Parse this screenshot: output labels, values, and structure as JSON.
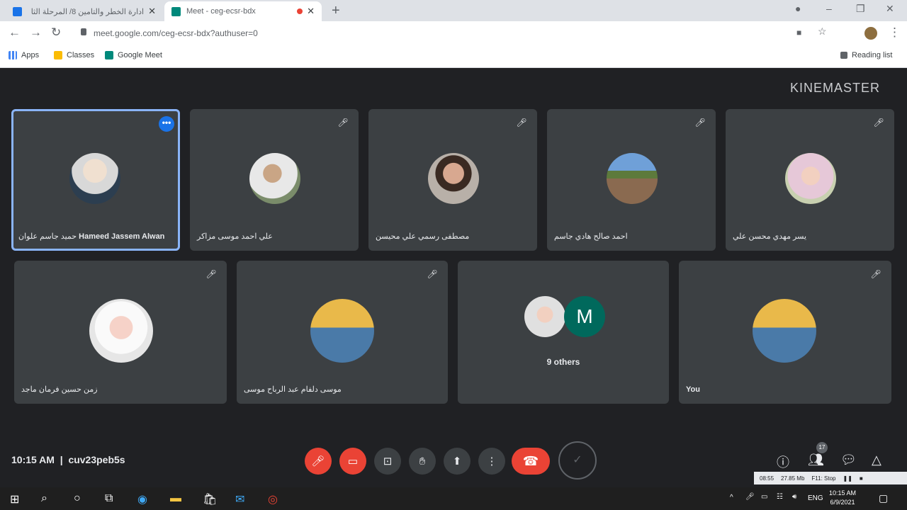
{
  "browser": {
    "tabs": [
      {
        "title": "ادارة الخطر والتامين 8/ المرحلة الثا"
      },
      {
        "title": "Meet - ceg-ecsr-bdx"
      }
    ],
    "url": "meet.google.com/ceg-ecsr-bdx?authuser=0",
    "bookmarks": [
      "Apps",
      "Classes",
      "Google Meet"
    ],
    "reading_list": "Reading list"
  },
  "watermark": "KINEMASTER",
  "participants": [
    {
      "name_ar": "حميد جاسم علوان",
      "name_en": "Hameed Jassem Alwan"
    },
    {
      "name_ar": "علي احمد موسى مزاكر"
    },
    {
      "name_ar": "مصطفى رسمي علي محيسن"
    },
    {
      "name_ar": "احمد صالح هادي جاسم"
    },
    {
      "name_ar": "يسر مهدي محسن علي"
    },
    {
      "name_ar": "زمن حسين فرمان ماجد"
    },
    {
      "name_ar": "موسى دلفام عبد الرباح موسى"
    }
  ],
  "others": {
    "initial": "M",
    "label": "9 others"
  },
  "you_label": "You",
  "meeting": {
    "time": "10:15 AM",
    "code": "cuv23peb5s",
    "people_count": "17"
  },
  "recorder": {
    "duration": "08:55",
    "size": "27.85 Mb",
    "stop": "F11: Stop"
  },
  "taskbar": {
    "lang": "ENG",
    "time": "10:15 AM",
    "date": "6/9/2021"
  },
  "colors": {
    "accent": "#8ab4f8",
    "danger": "#ea4335",
    "tile": "#3c4043",
    "bg": "#202124"
  }
}
